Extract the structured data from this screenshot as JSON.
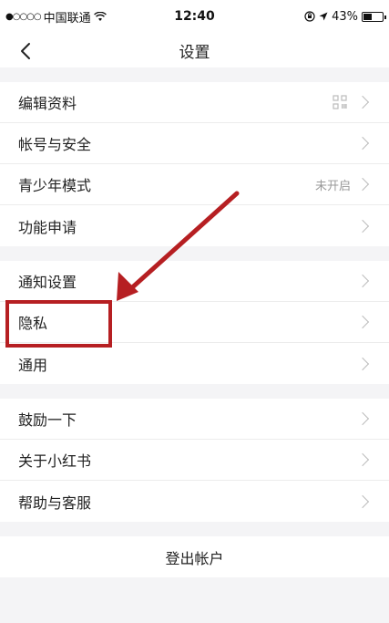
{
  "status_bar": {
    "carrier": "中国联通",
    "time": "12:40",
    "battery": "43%",
    "battery_level": 0.43
  },
  "nav": {
    "title": "设置"
  },
  "groups": [
    {
      "items": [
        {
          "label": "编辑资料",
          "icon": "qr-code-icon"
        },
        {
          "label": "帐号与安全"
        },
        {
          "label": "青少年模式",
          "value": "未开启"
        },
        {
          "label": "功能申请"
        }
      ]
    },
    {
      "items": [
        {
          "label": "通知设置"
        },
        {
          "label": "隐私"
        },
        {
          "label": "通用"
        }
      ]
    },
    {
      "items": [
        {
          "label": "鼓励一下"
        },
        {
          "label": "关于小红书"
        },
        {
          "label": "帮助与客服"
        }
      ]
    }
  ],
  "logout": {
    "label": "登出帐户"
  },
  "annotation": {
    "color": "#b61f22",
    "target": "隐私"
  }
}
